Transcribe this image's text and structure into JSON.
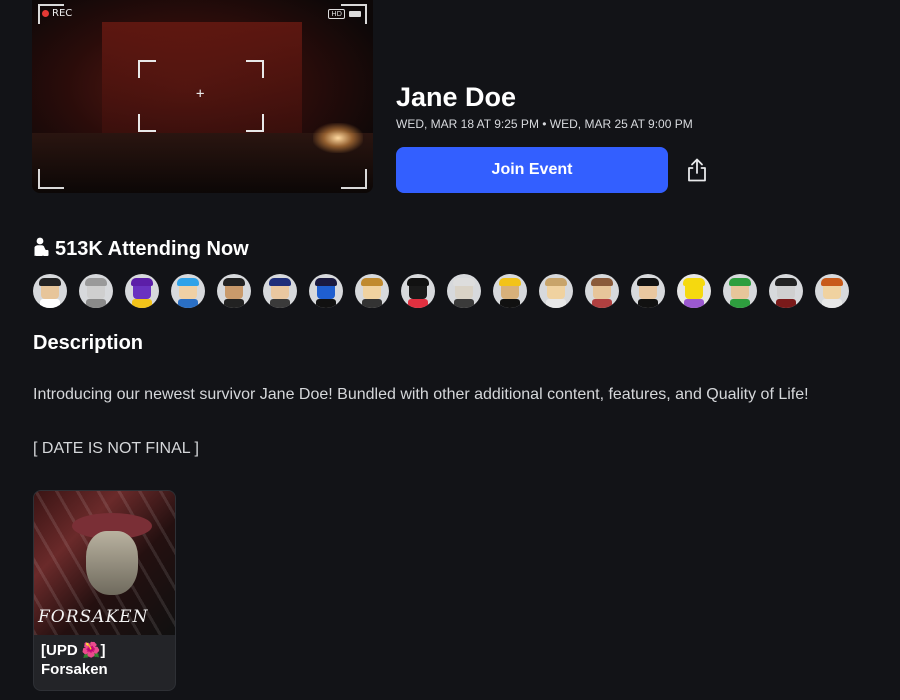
{
  "event": {
    "title": "Jane Doe",
    "dates": "WED, MAR 18 AT 9:25 PM • WED, MAR 25 AT 9:00 PM",
    "join_label": "Join Event",
    "share_icon": "share-icon"
  },
  "thumbnail": {
    "rec_label": "REC",
    "hd_label": "HD"
  },
  "attending": {
    "icon": "person-icon",
    "label": "513K Attending Now"
  },
  "avatars": [
    {
      "hair": "#222",
      "head": "#e7c59a",
      "body": "#ffffff",
      "bg": "#d7d9dc"
    },
    {
      "hair": "#9a9a9a",
      "head": "#cfcfcf",
      "body": "#8a8a8a",
      "bg": "#d7d9dc"
    },
    {
      "hair": "#5c1ea8",
      "head": "#6a32c0",
      "body": "#f2c31a",
      "bg": "#d7d9dc"
    },
    {
      "hair": "#2fa2e8",
      "head": "#efd0a5",
      "body": "#2a6fc4",
      "bg": "#d7d9dc"
    },
    {
      "hair": "#222",
      "head": "#c99a6b",
      "body": "#222",
      "bg": "#d7d9dc"
    },
    {
      "hair": "#1f2e7a",
      "head": "#e9c7a0",
      "body": "#3a3a3a",
      "bg": "#d7d9dc"
    },
    {
      "hair": "#1a1a40",
      "head": "#1f5fd0",
      "body": "#111",
      "bg": "#d7d9dc"
    },
    {
      "hair": "#c08a2f",
      "head": "#f0d2a0",
      "body": "#333",
      "bg": "#d7d9dc"
    },
    {
      "hair": "#111",
      "head": "#1a1a1a",
      "body": "#e03040",
      "bg": "#d7d9dc"
    },
    {
      "hair": "#ddd",
      "head": "#d9d2c6",
      "body": "#3a3a3a",
      "bg": "#d7d9dc"
    },
    {
      "hair": "#f2c31a",
      "head": "#d8b07a",
      "body": "#111",
      "bg": "#d7d9dc"
    },
    {
      "hair": "#c8a46a",
      "head": "#f0d2a0",
      "body": "#e8e8e8",
      "bg": "#d7d9dc"
    },
    {
      "hair": "#8a5a3a",
      "head": "#e7c59a",
      "body": "#b04040",
      "bg": "#d7d9dc"
    },
    {
      "hair": "#111",
      "head": "#e9c7a0",
      "body": "#111",
      "bg": "#d7d9dc"
    },
    {
      "hair": "#f5d90f",
      "head": "#f5d90f",
      "body": "#9b59d0",
      "bg": "#e6e6e6"
    },
    {
      "hair": "#2e9e3e",
      "head": "#e7c59a",
      "body": "#2e9e3e",
      "bg": "#d7d9dc"
    },
    {
      "hair": "#222",
      "head": "#cfcfcf",
      "body": "#7a1a1a",
      "bg": "#d7d9dc"
    },
    {
      "hair": "#c85a1a",
      "head": "#f0d2a0",
      "body": "#e8e8e8",
      "bg": "#d7d9dc"
    }
  ],
  "description": {
    "heading": "Description",
    "line1": "Introducing our newest survivor Jane Doe! Bundled with other additional content, features, and Quality of Life!",
    "line2": "[ DATE IS NOT FINAL ]"
  },
  "game": {
    "logo_text": "FORSAKEN",
    "title_line1": "[UPD 🌺]",
    "title_line2": "Forsaken"
  },
  "colors": {
    "background": "#121317",
    "accent": "#335fff",
    "text": "#ffffff"
  }
}
